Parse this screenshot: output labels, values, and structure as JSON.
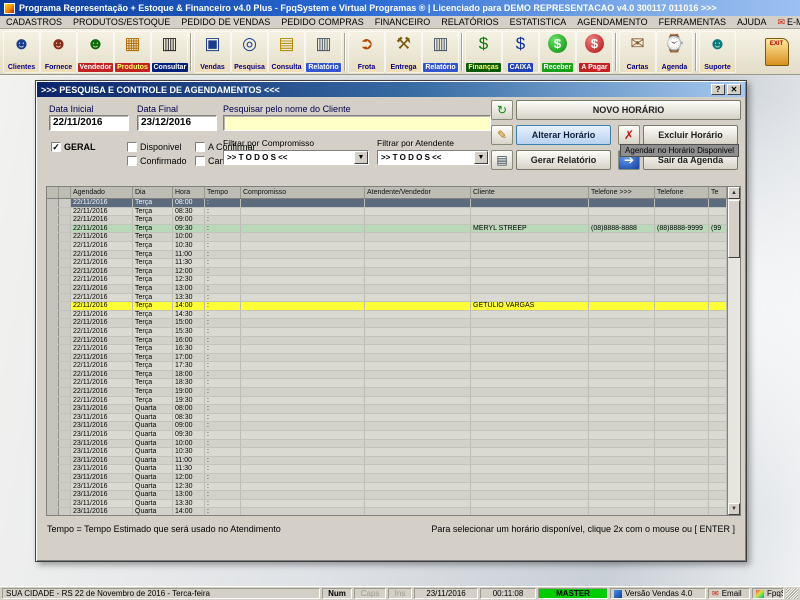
{
  "window": {
    "title": "Programa Representação + Estoque & Financeiro v4.0 Plus - FpqSystem e Virtual Programas ® | Licenciado para  DEMO REPRESENTACAO v4.0 300117 011016 >>>"
  },
  "menu": {
    "items": [
      "CADASTROS",
      "PRODUTOS/ESTOQUE",
      "PEDIDO DE VENDAS",
      "PEDIDO COMPRAS",
      "FINANCEIRO",
      "RELATÓRIOS",
      "ESTATISTICA",
      "AGENDAMENTO",
      "FERRAMENTAS",
      "AJUDA",
      "E-MAIL"
    ]
  },
  "toolbar": {
    "exit_label": "EXIT",
    "buttons": [
      {
        "label": "Clientes",
        "icon": "clients-icon",
        "label_bg": "#f0dfb8",
        "label_fg": "#00008b"
      },
      {
        "label": "Fornece",
        "icon": "suppliers-icon",
        "label_bg": "#f0dfb8",
        "label_fg": "#00008b"
      },
      {
        "label": "Vendedor",
        "icon": "salesman-icon",
        "label_bg": "#c22222",
        "label_fg": "#ffffff"
      },
      {
        "label": "Produtos",
        "icon": "products-icon",
        "label_bg": "#c22222",
        "label_fg": "#ffff66"
      },
      {
        "label": "Consultar",
        "icon": "barcode-icon",
        "label_bg": "#001f7a",
        "label_fg": "#ffffff",
        "sep_after": true
      },
      {
        "label": "Vendas",
        "icon": "sales-icon",
        "label_bg": "#f0dfb8",
        "label_fg": "#00008b"
      },
      {
        "label": "Pesquisa",
        "icon": "search-icon",
        "label_bg": "#f0dfb8",
        "label_fg": "#00008b"
      },
      {
        "label": "Consulta",
        "icon": "folder-icon",
        "label_bg": "#f0dfb8",
        "label_fg": "#00008b"
      },
      {
        "label": "Relatório",
        "icon": "report-icon",
        "label_bg": "#3355cc",
        "label_fg": "#ffffff",
        "sep_after": true
      },
      {
        "label": "Frota",
        "icon": "truck-icon",
        "label_bg": "#f0dfb8",
        "label_fg": "#00008b"
      },
      {
        "label": "Entrega",
        "icon": "delivery-icon",
        "label_bg": "#f0dfb8",
        "label_fg": "#00008b"
      },
      {
        "label": "Relatório",
        "icon": "report2-icon",
        "label_bg": "#3355cc",
        "label_fg": "#ffffff",
        "sep_after": true
      },
      {
        "label": "Finanças",
        "icon": "finance-icon",
        "label_bg": "#0a5a0a",
        "label_fg": "#ffff66"
      },
      {
        "label": "CAIXA",
        "icon": "cash-icon",
        "label_bg": "#2244bb",
        "label_fg": "#ffffff"
      },
      {
        "label": "Receber",
        "icon": "receive-icon",
        "label_bg": "#18a018",
        "label_fg": "#ffffff"
      },
      {
        "label": "A Pagar",
        "icon": "pay-icon",
        "label_bg": "#c22222",
        "label_fg": "#ffffff",
        "sep_after": true
      },
      {
        "label": "Cartas",
        "icon": "letters-icon",
        "label_bg": "#f0dfb8",
        "label_fg": "#00008b"
      },
      {
        "label": "Agenda",
        "icon": "agenda-icon",
        "label_bg": "#f0dfb8",
        "label_fg": "#00008b",
        "sep_after": true
      },
      {
        "label": "Suporte",
        "icon": "support-icon",
        "label_bg": "#f0dfb8",
        "label_fg": "#00008b"
      }
    ]
  },
  "dialog": {
    "title": ">>>  PESQUISA E CONTROLE DE AGENDAMENTOS  <<<",
    "titlebar_buttons": [
      "?",
      "✕"
    ],
    "form": {
      "data_inicial_label": "Data Inicial",
      "data_inicial_value": "22/11/2016",
      "data_final_label": "Data Final",
      "data_final_value": "23/12/2016",
      "search_label": "Pesquisar pelo nome do Cliente",
      "search_value": ""
    },
    "checkboxes": [
      {
        "label": "GERAL",
        "checked": true
      },
      {
        "label": "Disponivel",
        "checked": false
      },
      {
        "label": "A Confirmar",
        "checked": false
      },
      {
        "label": "Confirmado",
        "checked": false
      },
      {
        "label": "Cancelados",
        "checked": false
      }
    ],
    "filters": [
      {
        "label": "Filtrar por Compromisso",
        "value": ">> T O D O S <<"
      },
      {
        "label": "Filtrar por Atendente",
        "value": ">> T O D O S <<"
      }
    ],
    "actions": {
      "buttons": [
        {
          "icon": "refresh-icon",
          "label": "NOVO HORÁRIO",
          "id": "novo"
        },
        {
          "icon": "edit-icon",
          "label": "Alterar Horário",
          "id": "alterar",
          "highlight": true
        },
        {
          "icon": "delete-icon",
          "label": "Excluir Horário",
          "id": "excluir"
        },
        {
          "icon": "print-icon",
          "label": "Gerar Relatório",
          "id": "gerar"
        },
        {
          "icon": "exit-circle-icon",
          "label": "Sair da Agenda",
          "id": "sair"
        }
      ],
      "tooltip": "Agendar no Horário Disponivel"
    },
    "footer_left": "Tempo = Tempo Estimado que será usado no Atendimento",
    "footer_right": "Para selecionar um horário disponível, clique 2x com o mouse ou [ ENTER ]"
  },
  "table": {
    "headers": [
      "",
      "",
      "Agendado",
      "Dia",
      "Hora",
      "Tempo",
      "Compromisso",
      "Atendente/Vendedor",
      "Cliente",
      "Telefone >>>",
      "Telefone",
      "Te"
    ],
    "tempo_char": ":",
    "state_colors": {
      "selected": "#5c6b7d",
      "green": "#b9d9b9",
      "yellow": "#ffff38"
    },
    "rows": [
      {
        "d": "22/11/2016",
        "w": "Terça",
        "t": "08:00",
        "st": "selected"
      },
      {
        "d": "22/11/2016",
        "w": "Terça",
        "t": "08:30"
      },
      {
        "d": "22/11/2016",
        "w": "Terça",
        "t": "09:00"
      },
      {
        "d": "22/11/2016",
        "w": "Terça",
        "t": "09:30",
        "st": "green",
        "cli": "MERYL STREEP",
        "p1": "(08)8888-8888",
        "p2": "(88)8888-9999",
        "p3": "(99"
      },
      {
        "d": "22/11/2016",
        "w": "Terça",
        "t": "10:00"
      },
      {
        "d": "22/11/2016",
        "w": "Terça",
        "t": "10:30"
      },
      {
        "d": "22/11/2016",
        "w": "Terça",
        "t": "11:00"
      },
      {
        "d": "22/11/2016",
        "w": "Terça",
        "t": "11:30"
      },
      {
        "d": "22/11/2016",
        "w": "Terça",
        "t": "12:00"
      },
      {
        "d": "22/11/2016",
        "w": "Terça",
        "t": "12:30"
      },
      {
        "d": "22/11/2016",
        "w": "Terça",
        "t": "13:00"
      },
      {
        "d": "22/11/2016",
        "w": "Terça",
        "t": "13:30"
      },
      {
        "d": "22/11/2016",
        "w": "Terça",
        "t": "14:00",
        "st": "yellow",
        "cli": "GETULIO VARGAS"
      },
      {
        "d": "22/11/2016",
        "w": "Terça",
        "t": "14:30"
      },
      {
        "d": "22/11/2016",
        "w": "Terça",
        "t": "15:00"
      },
      {
        "d": "22/11/2016",
        "w": "Terça",
        "t": "15:30"
      },
      {
        "d": "22/11/2016",
        "w": "Terça",
        "t": "16:00"
      },
      {
        "d": "22/11/2016",
        "w": "Terça",
        "t": "16:30"
      },
      {
        "d": "22/11/2016",
        "w": "Terça",
        "t": "17:00"
      },
      {
        "d": "22/11/2016",
        "w": "Terça",
        "t": "17:30"
      },
      {
        "d": "22/11/2016",
        "w": "Terça",
        "t": "18:00"
      },
      {
        "d": "22/11/2016",
        "w": "Terça",
        "t": "18:30"
      },
      {
        "d": "22/11/2016",
        "w": "Terça",
        "t": "19:00"
      },
      {
        "d": "22/11/2016",
        "w": "Terça",
        "t": "19:30"
      },
      {
        "d": "23/11/2016",
        "w": "Quarta",
        "t": "08:00"
      },
      {
        "d": "23/11/2016",
        "w": "Quarta",
        "t": "08:30"
      },
      {
        "d": "23/11/2016",
        "w": "Quarta",
        "t": "09:00"
      },
      {
        "d": "23/11/2016",
        "w": "Quarta",
        "t": "09:30"
      },
      {
        "d": "23/11/2016",
        "w": "Quarta",
        "t": "10:00"
      },
      {
        "d": "23/11/2016",
        "w": "Quarta",
        "t": "10:30"
      },
      {
        "d": "23/11/2016",
        "w": "Quarta",
        "t": "11:00"
      },
      {
        "d": "23/11/2016",
        "w": "Quarta",
        "t": "11:30"
      },
      {
        "d": "23/11/2016",
        "w": "Quarta",
        "t": "12:00"
      },
      {
        "d": "23/11/2016",
        "w": "Quarta",
        "t": "12:30"
      },
      {
        "d": "23/11/2016",
        "w": "Quarta",
        "t": "13:00"
      },
      {
        "d": "23/11/2016",
        "w": "Quarta",
        "t": "13:30"
      },
      {
        "d": "23/11/2016",
        "w": "Quarta",
        "t": "14:00"
      }
    ]
  },
  "statusbar": {
    "location": "SUA CIDADE - RS 22 de Novembro de 2016 - Terca-feira",
    "indicators": [
      "Num",
      "Caps",
      "Ins"
    ],
    "date": "23/11/2016",
    "time": "00:11:08",
    "user": "MASTER",
    "version": "Versão Vendas 4.0",
    "email": "Email",
    "brand": "FpqSystem"
  }
}
